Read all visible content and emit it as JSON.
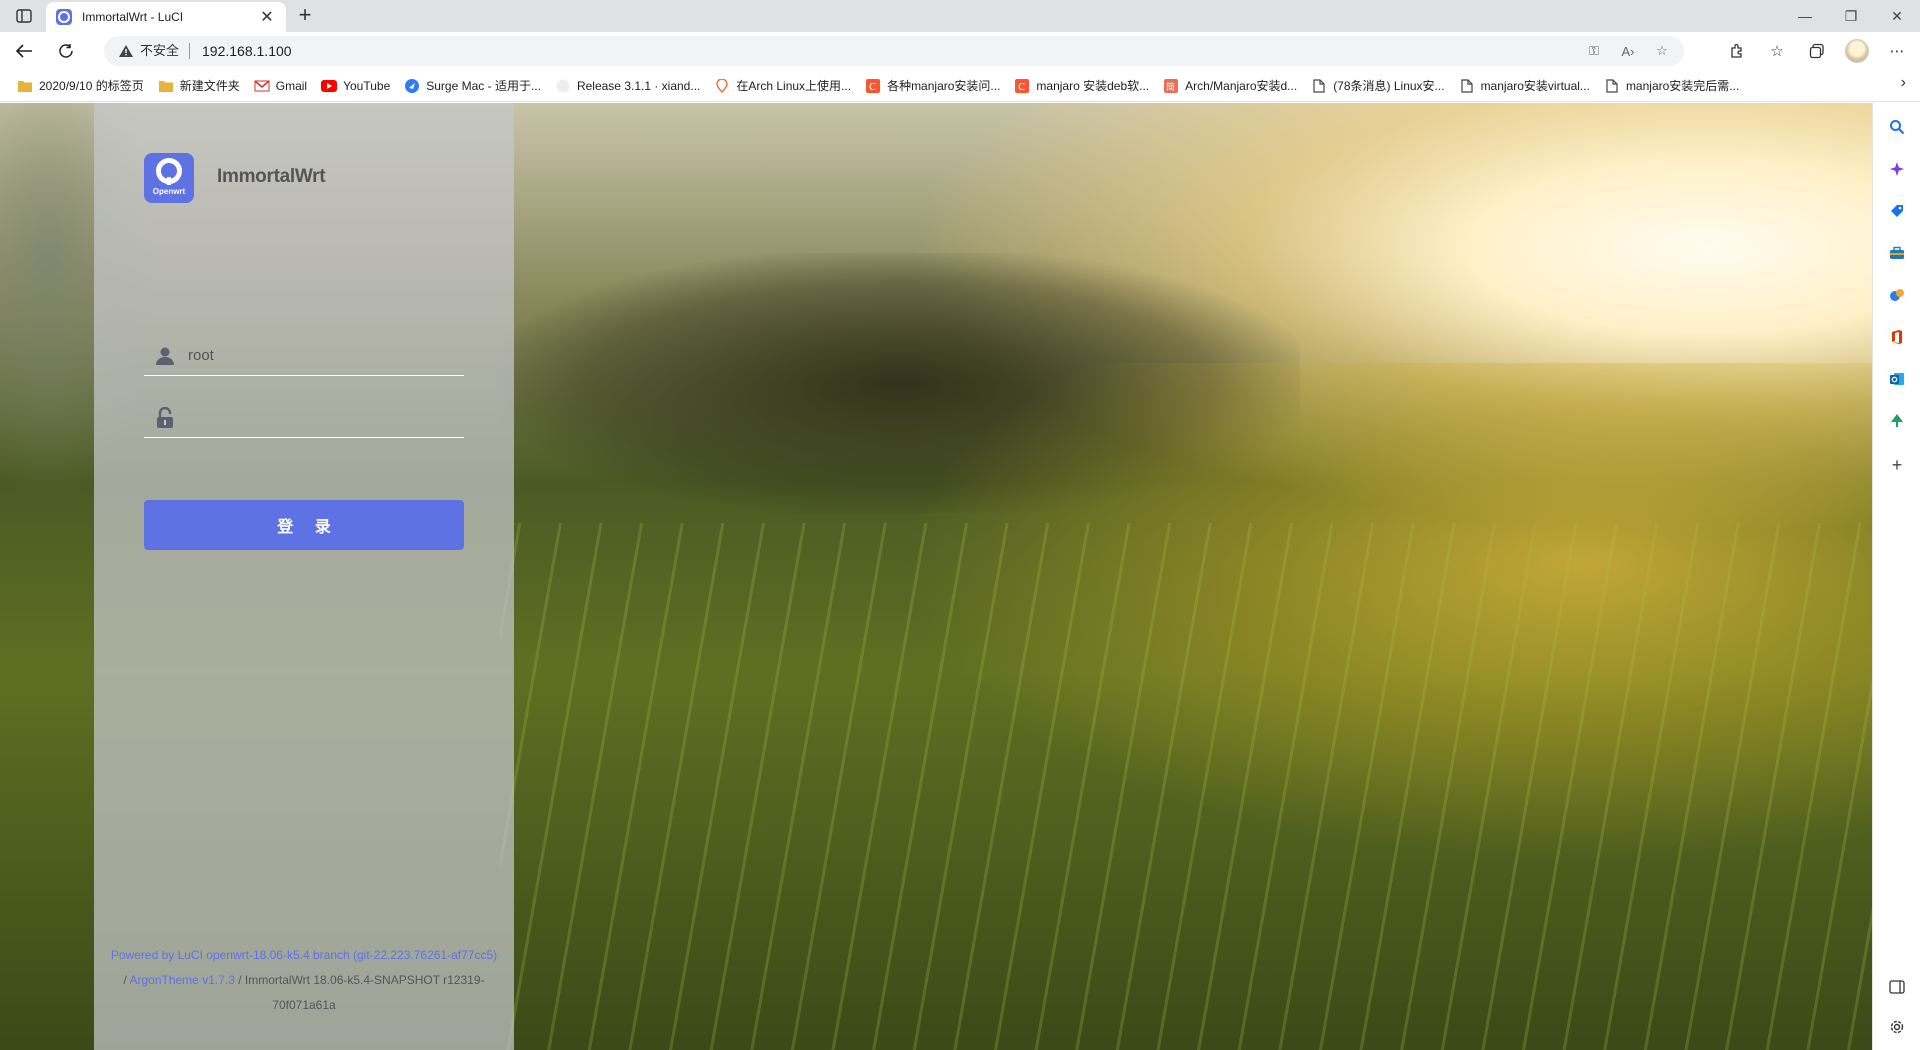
{
  "browser": {
    "tab": {
      "title": "ImmortalWrt - LuCI"
    },
    "omnibox": {
      "security_label": "不安全",
      "url": "192.168.1.100"
    },
    "bookmarks": [
      {
        "label": "2020/9/10 的标签页",
        "icon": "folder-icon"
      },
      {
        "label": "新建文件夹",
        "icon": "folder-icon"
      },
      {
        "label": "Gmail",
        "icon": "gmail-icon"
      },
      {
        "label": "YouTube",
        "icon": "youtube-icon"
      },
      {
        "label": "Surge Mac - 适用于...",
        "icon": "surge-icon"
      },
      {
        "label": "Release 3.1.1 · xiand...",
        "icon": "github-icon"
      },
      {
        "label": "在Arch Linux上使用...",
        "icon": "pin-icon"
      },
      {
        "label": "各种manjaro安装问...",
        "icon": "csdn-icon"
      },
      {
        "label": "manjaro 安装deb软...",
        "icon": "csdn-icon"
      },
      {
        "label": "Arch/Manjaro安装d...",
        "icon": "jianshu-icon"
      },
      {
        "label": "(78条消息) Linux安...",
        "icon": "page-icon"
      },
      {
        "label": "manjaro安装virtual...",
        "icon": "page-icon"
      },
      {
        "label": "manjaro安装完后需...",
        "icon": "page-icon"
      }
    ]
  },
  "login": {
    "logo_text": "Openwrt",
    "brand": "ImmortalWrt",
    "username_value": "root",
    "password_value": "",
    "submit_label": "登 录",
    "footer": {
      "powered_by": "Powered by LuCI openwrt-18.06-k5.4 branch (git-22.223.76261-af77cc5)",
      "sep1": "/ ",
      "theme": "ArgonTheme v1.7.3",
      "release": " / ImmortalWrt 18.06-k5.4-SNAPSHOT r12319-",
      "revision": "70f071a61a"
    }
  },
  "colors": {
    "accent": "#5e72e4",
    "panel": "#c6c8cc",
    "tabstrip": "#dfe1e5"
  }
}
